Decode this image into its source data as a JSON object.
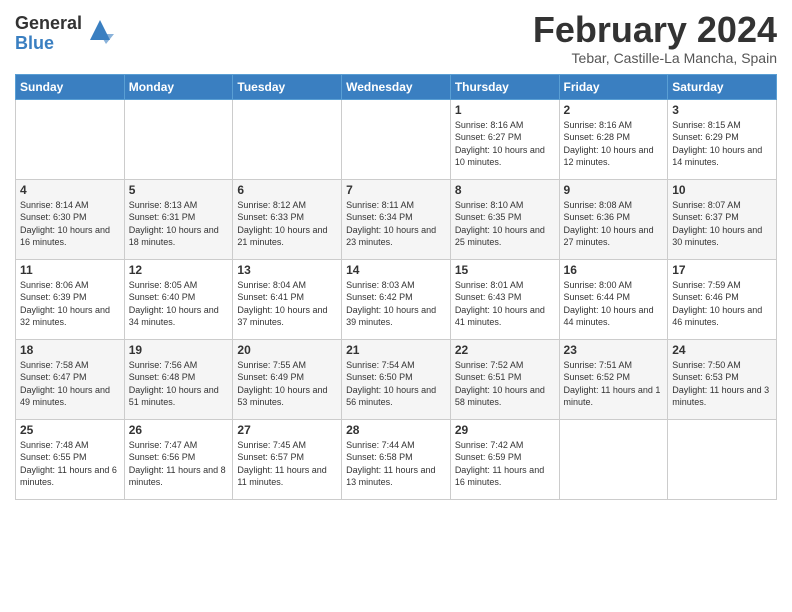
{
  "header": {
    "logo_general": "General",
    "logo_blue": "Blue",
    "title": "February 2024",
    "location": "Tebar, Castille-La Mancha, Spain"
  },
  "days_of_week": [
    "Sunday",
    "Monday",
    "Tuesday",
    "Wednesday",
    "Thursday",
    "Friday",
    "Saturday"
  ],
  "weeks": [
    [
      {
        "day": "",
        "sunrise": "",
        "sunset": "",
        "daylight": ""
      },
      {
        "day": "",
        "sunrise": "",
        "sunset": "",
        "daylight": ""
      },
      {
        "day": "",
        "sunrise": "",
        "sunset": "",
        "daylight": ""
      },
      {
        "day": "",
        "sunrise": "",
        "sunset": "",
        "daylight": ""
      },
      {
        "day": "1",
        "sunrise": "8:16 AM",
        "sunset": "6:27 PM",
        "daylight": "10 hours and 10 minutes."
      },
      {
        "day": "2",
        "sunrise": "8:16 AM",
        "sunset": "6:28 PM",
        "daylight": "10 hours and 12 minutes."
      },
      {
        "day": "3",
        "sunrise": "8:15 AM",
        "sunset": "6:29 PM",
        "daylight": "10 hours and 14 minutes."
      }
    ],
    [
      {
        "day": "4",
        "sunrise": "8:14 AM",
        "sunset": "6:30 PM",
        "daylight": "10 hours and 16 minutes."
      },
      {
        "day": "5",
        "sunrise": "8:13 AM",
        "sunset": "6:31 PM",
        "daylight": "10 hours and 18 minutes."
      },
      {
        "day": "6",
        "sunrise": "8:12 AM",
        "sunset": "6:33 PM",
        "daylight": "10 hours and 21 minutes."
      },
      {
        "day": "7",
        "sunrise": "8:11 AM",
        "sunset": "6:34 PM",
        "daylight": "10 hours and 23 minutes."
      },
      {
        "day": "8",
        "sunrise": "8:10 AM",
        "sunset": "6:35 PM",
        "daylight": "10 hours and 25 minutes."
      },
      {
        "day": "9",
        "sunrise": "8:08 AM",
        "sunset": "6:36 PM",
        "daylight": "10 hours and 27 minutes."
      },
      {
        "day": "10",
        "sunrise": "8:07 AM",
        "sunset": "6:37 PM",
        "daylight": "10 hours and 30 minutes."
      }
    ],
    [
      {
        "day": "11",
        "sunrise": "8:06 AM",
        "sunset": "6:39 PM",
        "daylight": "10 hours and 32 minutes."
      },
      {
        "day": "12",
        "sunrise": "8:05 AM",
        "sunset": "6:40 PM",
        "daylight": "10 hours and 34 minutes."
      },
      {
        "day": "13",
        "sunrise": "8:04 AM",
        "sunset": "6:41 PM",
        "daylight": "10 hours and 37 minutes."
      },
      {
        "day": "14",
        "sunrise": "8:03 AM",
        "sunset": "6:42 PM",
        "daylight": "10 hours and 39 minutes."
      },
      {
        "day": "15",
        "sunrise": "8:01 AM",
        "sunset": "6:43 PM",
        "daylight": "10 hours and 41 minutes."
      },
      {
        "day": "16",
        "sunrise": "8:00 AM",
        "sunset": "6:44 PM",
        "daylight": "10 hours and 44 minutes."
      },
      {
        "day": "17",
        "sunrise": "7:59 AM",
        "sunset": "6:46 PM",
        "daylight": "10 hours and 46 minutes."
      }
    ],
    [
      {
        "day": "18",
        "sunrise": "7:58 AM",
        "sunset": "6:47 PM",
        "daylight": "10 hours and 49 minutes."
      },
      {
        "day": "19",
        "sunrise": "7:56 AM",
        "sunset": "6:48 PM",
        "daylight": "10 hours and 51 minutes."
      },
      {
        "day": "20",
        "sunrise": "7:55 AM",
        "sunset": "6:49 PM",
        "daylight": "10 hours and 53 minutes."
      },
      {
        "day": "21",
        "sunrise": "7:54 AM",
        "sunset": "6:50 PM",
        "daylight": "10 hours and 56 minutes."
      },
      {
        "day": "22",
        "sunrise": "7:52 AM",
        "sunset": "6:51 PM",
        "daylight": "10 hours and 58 minutes."
      },
      {
        "day": "23",
        "sunrise": "7:51 AM",
        "sunset": "6:52 PM",
        "daylight": "11 hours and 1 minute."
      },
      {
        "day": "24",
        "sunrise": "7:50 AM",
        "sunset": "6:53 PM",
        "daylight": "11 hours and 3 minutes."
      }
    ],
    [
      {
        "day": "25",
        "sunrise": "7:48 AM",
        "sunset": "6:55 PM",
        "daylight": "11 hours and 6 minutes."
      },
      {
        "day": "26",
        "sunrise": "7:47 AM",
        "sunset": "6:56 PM",
        "daylight": "11 hours and 8 minutes."
      },
      {
        "day": "27",
        "sunrise": "7:45 AM",
        "sunset": "6:57 PM",
        "daylight": "11 hours and 11 minutes."
      },
      {
        "day": "28",
        "sunrise": "7:44 AM",
        "sunset": "6:58 PM",
        "daylight": "11 hours and 13 minutes."
      },
      {
        "day": "29",
        "sunrise": "7:42 AM",
        "sunset": "6:59 PM",
        "daylight": "11 hours and 16 minutes."
      },
      {
        "day": "",
        "sunrise": "",
        "sunset": "",
        "daylight": ""
      },
      {
        "day": "",
        "sunrise": "",
        "sunset": "",
        "daylight": ""
      }
    ]
  ]
}
